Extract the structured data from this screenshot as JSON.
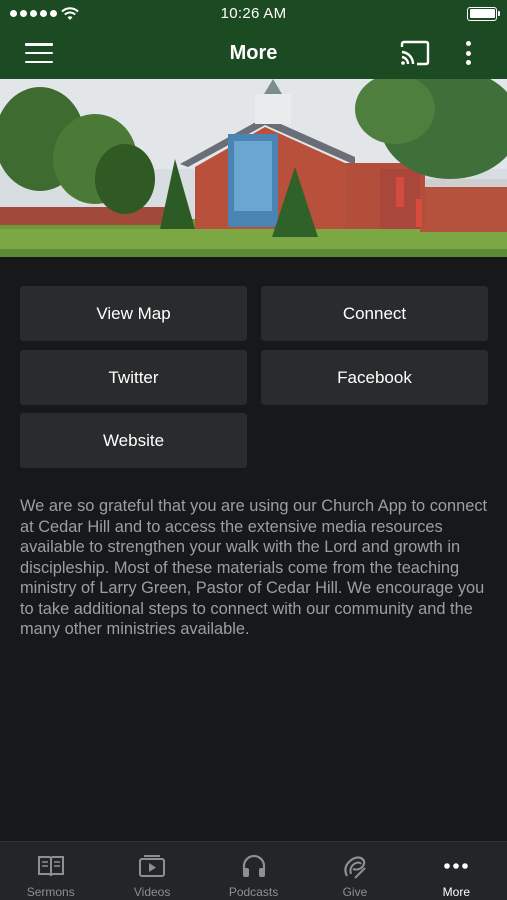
{
  "status_bar": {
    "time": "10:26 AM"
  },
  "header": {
    "title": "More"
  },
  "buttons": [
    {
      "id": "view-map",
      "label": "View Map"
    },
    {
      "id": "connect",
      "label": "Connect"
    },
    {
      "id": "twitter",
      "label": "Twitter"
    },
    {
      "id": "facebook",
      "label": "Facebook"
    },
    {
      "id": "website",
      "label": "Website"
    }
  ],
  "description": "We are so grateful that you are using our Church App to connect at Cedar Hill and to access the extensive media resources available to strengthen your walk with the Lord and growth in discipleship.  Most of these materials come from the teaching ministry of Larry Green, Pastor of Cedar Hill. We encourage you to take additional steps to connect with our community and the many other ministries available.",
  "tabs": [
    {
      "label": "Sermons",
      "icon": "book-icon"
    },
    {
      "label": "Videos",
      "icon": "video-play-icon"
    },
    {
      "label": "Podcasts",
      "icon": "headphones-icon"
    },
    {
      "label": "Give",
      "icon": "give-icon"
    },
    {
      "label": "More",
      "icon": "more-dots-icon",
      "active": true
    }
  ],
  "colors": {
    "brand_green": "#1c4a23",
    "background": "#17181a",
    "button": "#2a2b2d",
    "text_muted": "#9c9ea1"
  }
}
